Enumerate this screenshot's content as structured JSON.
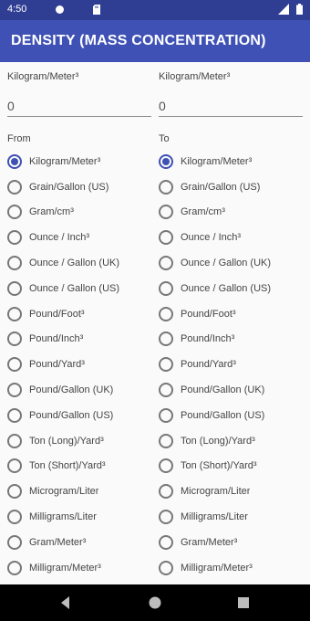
{
  "status_bar": {
    "time": "4:50"
  },
  "app_bar": {
    "title": "DENSITY (MASS CONCENTRATION)"
  },
  "from": {
    "unit_label": "Kilogram/Meter³",
    "value": "0",
    "section_label": "From",
    "selected_index": 0
  },
  "to": {
    "unit_label": "Kilogram/Meter³",
    "value": "0",
    "section_label": "To",
    "selected_index": 0
  },
  "units": [
    "Kilogram/Meter³",
    "Grain/Gallon (US)",
    "Gram/cm³",
    "Ounce / Inch³",
    "Ounce / Gallon (UK)",
    "Ounce / Gallon (US)",
    "Pound/Foot³",
    "Pound/Inch³",
    "Pound/Yard³",
    "Pound/Gallon (UK)",
    "Pound/Gallon (US)",
    "Ton (Long)/Yard³",
    "Ton (Short)/Yard³",
    "Microgram/Liter",
    "Milligrams/Liter",
    "Gram/Meter³",
    "Milligram/Meter³"
  ],
  "colors": {
    "status_bar": "#2f3e93",
    "app_bar": "#3f51b5",
    "accent": "#3f51b5"
  },
  "icons": [
    "circle-icon",
    "sd-card-icon",
    "signal-icon",
    "battery-icon",
    "back-icon",
    "home-icon",
    "recents-icon"
  ]
}
